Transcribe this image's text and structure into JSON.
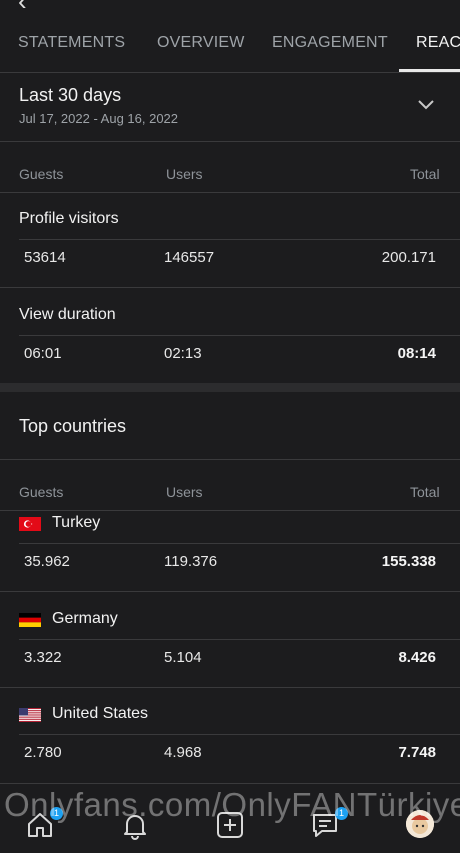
{
  "header": {
    "back_glyph": "‹"
  },
  "tabs": [
    {
      "label": "STATEMENTS"
    },
    {
      "label": "OVERVIEW"
    },
    {
      "label": "ENGAGEMENT"
    },
    {
      "label": "REACH"
    }
  ],
  "period": {
    "title": "Last 30 days",
    "range": "Jul 17, 2022 - Aug 16, 2022"
  },
  "columns": {
    "guests": "Guests",
    "users": "Users",
    "total": "Total"
  },
  "stats": [
    {
      "label": "Profile visitors",
      "guests": "53614",
      "users": "146557",
      "total": "200.171"
    },
    {
      "label": "View duration",
      "guests": "06:01",
      "users": "02:13",
      "total": "08:14"
    }
  ],
  "top_countries": {
    "title": "Top countries",
    "items": [
      {
        "name": "Turkey",
        "flag": "tr-flag",
        "guests": "35.962",
        "users": "119.376",
        "total": "155.338"
      },
      {
        "name": "Germany",
        "flag": "de-flag",
        "guests": "3.322",
        "users": "5.104",
        "total": "8.426"
      },
      {
        "name": "United States",
        "flag": "us-flag",
        "guests": "2.780",
        "users": "4.968",
        "total": "7.748"
      }
    ]
  },
  "nav": {
    "items": [
      "home-icon",
      "bell-icon",
      "add-post-icon",
      "messages-icon",
      "avatar"
    ],
    "home_badge": "1",
    "messages_badge": "1"
  },
  "watermark": "Onlyfans.com/OnlyFANTürkiye",
  "colors": {
    "background": "#1c1c1e",
    "text": "#e8e8e8",
    "muted": "#8e9399",
    "divider": "#3a3a3c",
    "badge": "#1da1f2"
  }
}
